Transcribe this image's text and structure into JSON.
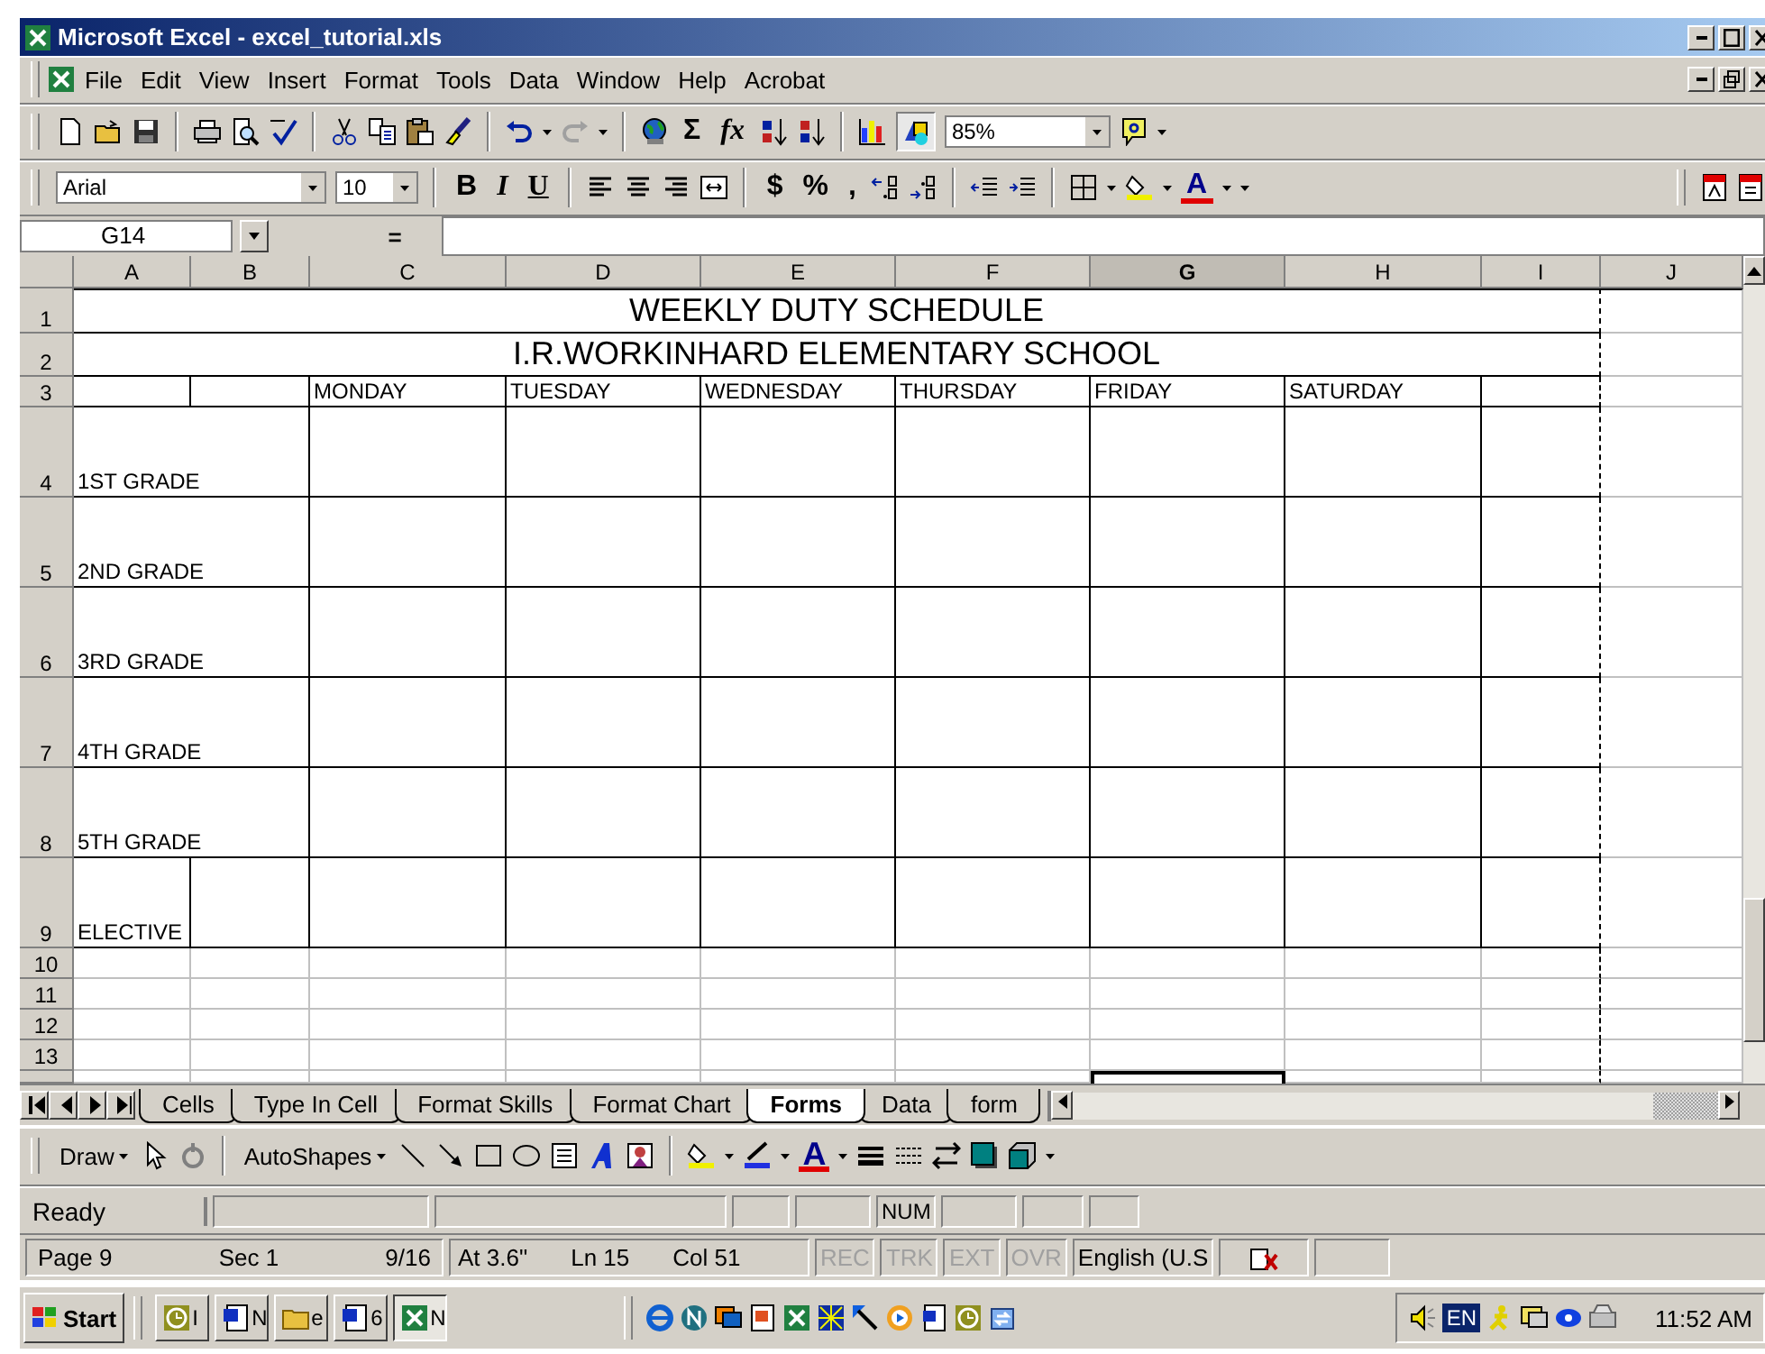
{
  "window": {
    "title": "Microsoft Excel - excel_tutorial.xls"
  },
  "menu": [
    "File",
    "Edit",
    "View",
    "Insert",
    "Format",
    "Tools",
    "Data",
    "Window",
    "Help",
    "Acrobat"
  ],
  "standard_toolbar": {
    "sum": "Σ",
    "function": "fx",
    "zoom": "85%"
  },
  "formatting_toolbar": {
    "font": "Arial",
    "size": "10",
    "bold": "B",
    "italic": "I",
    "underline": "U",
    "currency": "$",
    "percent": "%",
    "comma": ",",
    "font_color": "A"
  },
  "formula_bar": {
    "name_box": "G14",
    "equals": "="
  },
  "sheet": {
    "columns": [
      {
        "label": "A",
        "selected": false
      },
      {
        "label": "B",
        "selected": false
      },
      {
        "label": "C",
        "selected": false
      },
      {
        "label": "D",
        "selected": false
      },
      {
        "label": "E",
        "selected": false
      },
      {
        "label": "F",
        "selected": false
      },
      {
        "label": "G",
        "selected": true
      },
      {
        "label": "H",
        "selected": false
      },
      {
        "label": "I",
        "selected": false
      },
      {
        "label": "J",
        "selected": false
      }
    ],
    "rows": [
      {
        "header": "1",
        "kind": "title",
        "text": "WEEKLY DUTY SCHEDULE"
      },
      {
        "header": "2",
        "kind": "title",
        "text": "I.R.WORKINHARD ELEMENTARY SCHOOL"
      },
      {
        "header": "3",
        "kind": "days",
        "cells": [
          "MONDAY",
          "TUESDAY",
          "WEDNESDAY",
          "THURSDAY",
          "FRIDAY",
          "SATURDAY"
        ]
      },
      {
        "header": "4",
        "kind": "grade",
        "text": "1ST GRADE"
      },
      {
        "header": "5",
        "kind": "grade",
        "text": "2ND GRADE"
      },
      {
        "header": "6",
        "kind": "grade",
        "text": "3RD GRADE"
      },
      {
        "header": "7",
        "kind": "grade",
        "text": "4TH GRADE"
      },
      {
        "header": "8",
        "kind": "grade",
        "text": "5TH GRADE"
      },
      {
        "header": "9",
        "kind": "elective",
        "text": "ELECTIVE"
      },
      {
        "header": "10",
        "kind": "blank"
      },
      {
        "header": "11",
        "kind": "blank"
      },
      {
        "header": "12",
        "kind": "blank"
      },
      {
        "header": "13",
        "kind": "blank"
      }
    ]
  },
  "sheet_tabs": [
    {
      "label": "Cells",
      "selected": false
    },
    {
      "label": "Type In Cell",
      "selected": false
    },
    {
      "label": "Format Skills",
      "selected": false
    },
    {
      "label": "Format Chart",
      "selected": false
    },
    {
      "label": "Forms",
      "selected": true
    },
    {
      "label": "Data",
      "selected": false
    },
    {
      "label": "form",
      "selected": false
    }
  ],
  "drawing_toolbar": {
    "draw": "Draw",
    "autoshapes": "AutoShapes",
    "font_color": "A"
  },
  "status_bar": {
    "text": "Ready",
    "num": "NUM"
  },
  "word_status_bar": {
    "page": "Page 9",
    "section": "Sec 1",
    "pages": "9/16",
    "at": "At 3.6\"",
    "line": "Ln 15",
    "column": "Col 51",
    "modes": [
      {
        "label": "REC",
        "disabled": true
      },
      {
        "label": "TRK",
        "disabled": true
      },
      {
        "label": "EXT",
        "disabled": true
      },
      {
        "label": "OVR",
        "disabled": true
      }
    ],
    "language": "English (U.S"
  },
  "taskbar": {
    "start": "Start",
    "tasks": [
      {
        "kind": "clock",
        "label": "I",
        "selected": false
      },
      {
        "kind": "word",
        "label": "N",
        "selected": false
      },
      {
        "kind": "folder",
        "label": "e",
        "selected": false
      },
      {
        "kind": "word",
        "label": "6",
        "selected": false
      },
      {
        "kind": "excel",
        "label": "N",
        "selected": true
      }
    ],
    "language": "EN",
    "clock": "11:52 AM"
  }
}
